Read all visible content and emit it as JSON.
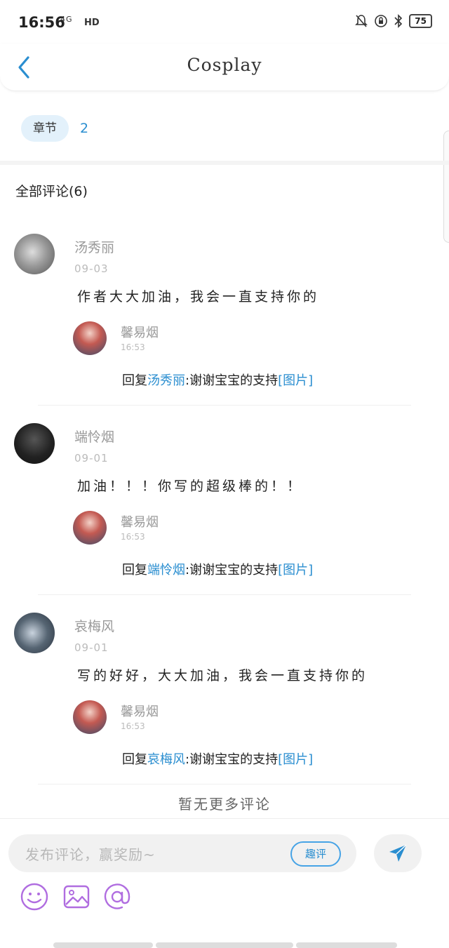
{
  "status": {
    "time": "16:56",
    "network": "4G",
    "hd": "HD",
    "battery": "75"
  },
  "header": {
    "title": "Cosplay"
  },
  "chapter": {
    "label": "章节",
    "number": "2"
  },
  "all_comments_label": "全部评论(6)",
  "comments": [
    {
      "name": "汤秀丽",
      "date": "09-03",
      "text": "作者大大加油，我会一直支持你的",
      "reply": {
        "name": "馨易烟",
        "date": "16:53",
        "prefix": "回复",
        "target": "汤秀丽",
        "content": ":谢谢宝宝的支持",
        "image_tag": "[图片]"
      }
    },
    {
      "name": "端怜烟",
      "date": "09-01",
      "text": "加油！！！你写的超级棒的！！",
      "reply": {
        "name": "馨易烟",
        "date": "16:53",
        "prefix": "回复",
        "target": "端怜烟",
        "content": ":谢谢宝宝的支持",
        "image_tag": "[图片]"
      }
    },
    {
      "name": "哀梅风",
      "date": "09-01",
      "text": "写的好好，大大加油，我会一直支持你的",
      "reply": {
        "name": "馨易烟",
        "date": "16:53",
        "prefix": "回复",
        "target": "哀梅风",
        "content": ":谢谢宝宝的支持",
        "image_tag": "[图片]"
      }
    }
  ],
  "no_more": "暂无更多评论",
  "input": {
    "placeholder": "发布评论，赢奖励~",
    "qupin_label": "趣评"
  },
  "colors": {
    "accent": "#2a8ed0",
    "tool_purple": "#b06de0"
  },
  "icons": [
    "back-arrow-icon",
    "send-icon",
    "emoji-icon",
    "image-icon",
    "at-icon"
  ]
}
